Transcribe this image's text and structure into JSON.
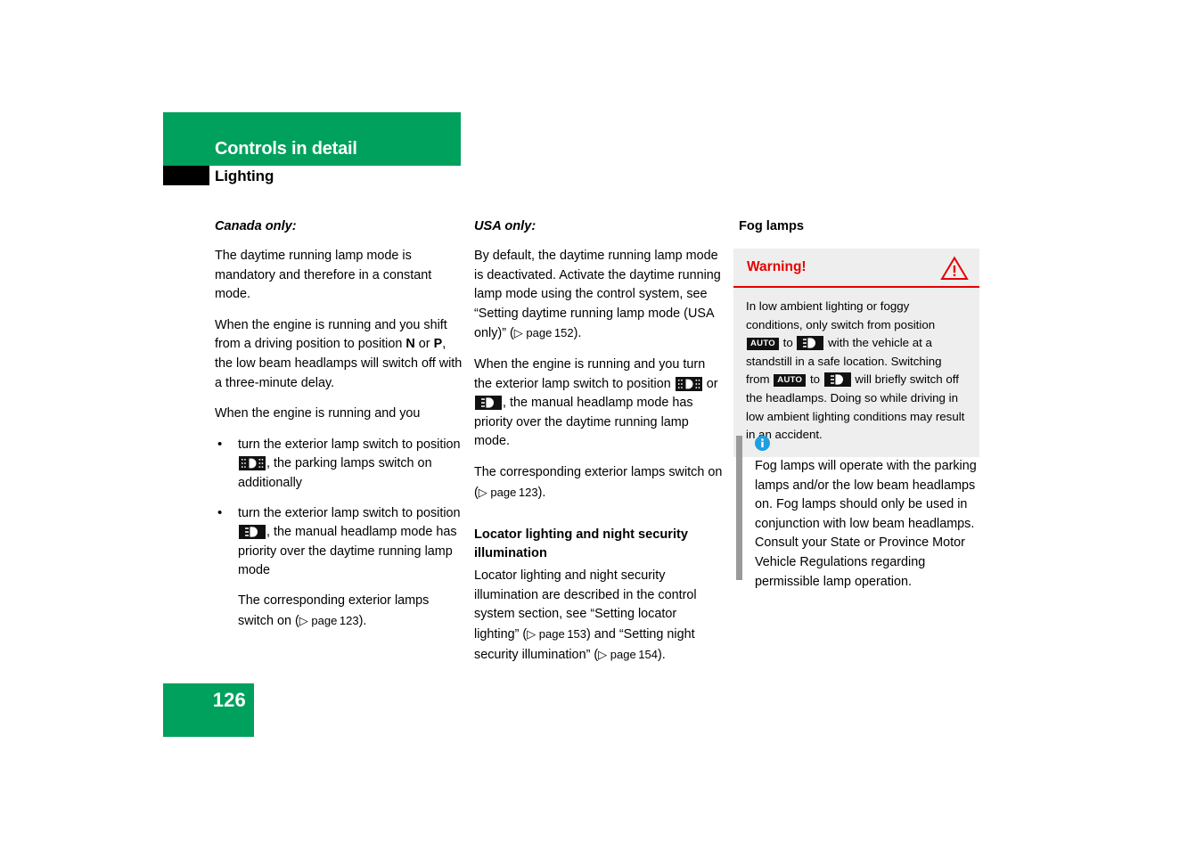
{
  "header": {
    "title": "Controls in detail",
    "subtitle": "Lighting",
    "band_color": "#00a15c",
    "tab_color": "#000000"
  },
  "columns": {
    "left": {
      "heading": "Canada only:",
      "paragraphs": [
        "The daytime running lamp mode is mandatory and therefore in a constant mode.",
        "When the engine is running and you shift from a driving position to position ",
        "When the engine is running and you"
      ],
      "gear_n": "N",
      "gear_or": " or ",
      "gear_p": "P",
      "para2_tail": ", the low beam headlamps will switch off with a three-minute delay.",
      "bullets": [
        {
          "before_icon": "turn the exterior lamp switch to position ",
          "icon": "parking-lamp-icon",
          "after_icon": ", the parking lamps switch on additionally"
        },
        {
          "before_icon": "turn the exterior lamp switch to position ",
          "icon": "low-beam-headlamp-icon",
          "after_icon": ", the manual headlamp mode has priority over the daytime running lamp mode"
        }
      ],
      "sub_para_before": "The corresponding exterior lamps switch on (",
      "sub_para_pageref": "▷ page 123",
      "sub_para_after": ")."
    },
    "mid": {
      "heading": "USA only:",
      "para1_before": "By default, the daytime running lamp mode is deactivated. Activate the daytime running lamp mode using the control system, see “Setting daytime running lamp mode (USA only)” (",
      "para1_pageref": "▷ page 152",
      "para1_after": ").",
      "para2_before": "When the engine is running and you turn the exterior lamp switch to position ",
      "para2_icon1": "parking-lamp-icon",
      "para2_mid": " or ",
      "para2_icon2": "low-beam-headlamp-icon",
      "para2_after": ", the manual headlamp mode has priority over the daytime running lamp mode.",
      "para3_before": "The corresponding exterior lamps switch on (",
      "para3_pageref": "▷ page 123",
      "para3_after": ").",
      "subheading": "Locator lighting and night security illumination",
      "para4_before": "Locator lighting and night security illumination are described in the control system section, see “Setting locator lighting” (",
      "para4_pageref1": "▷ page 153",
      "para4_mid": ") and “Setting night security illumination” (",
      "para4_pageref2": "▷ page 154",
      "para4_after": ")."
    },
    "right": {
      "heading": "Fog lamps",
      "warning": {
        "label": "Warning!",
        "icon": "warning-triangle-icon",
        "accent_color": "#e60000",
        "background_color": "#eeeeee",
        "text_before_auto1": "In low ambient lighting or foggy conditions, only switch from position ",
        "auto1": "AUTO",
        "text_to1": " to ",
        "icon1": "low-beam-headlamp-icon",
        "text_mid": " with the vehicle at a standstill in a safe location. Switching from ",
        "auto2": "AUTO",
        "text_to2": " to ",
        "icon2": "low-beam-headlamp-icon",
        "text_after": " will briefly switch off the headlamps. Doing so while driving in low ambient lighting conditions may result in an accident."
      },
      "note": {
        "icon": "info-icon",
        "bar_color": "#9a9a9a",
        "icon_color": "#1e9fe0",
        "text": "Fog lamps will operate with the parking lamps and/or the low beam headlamps on. Fog lamps should only be used in conjunction with low beam headlamps. Consult your State or Province Motor Vehicle Regulations regarding permissible lamp operation."
      }
    }
  },
  "footer": {
    "page_number": "126",
    "block_color": "#00a15c"
  }
}
